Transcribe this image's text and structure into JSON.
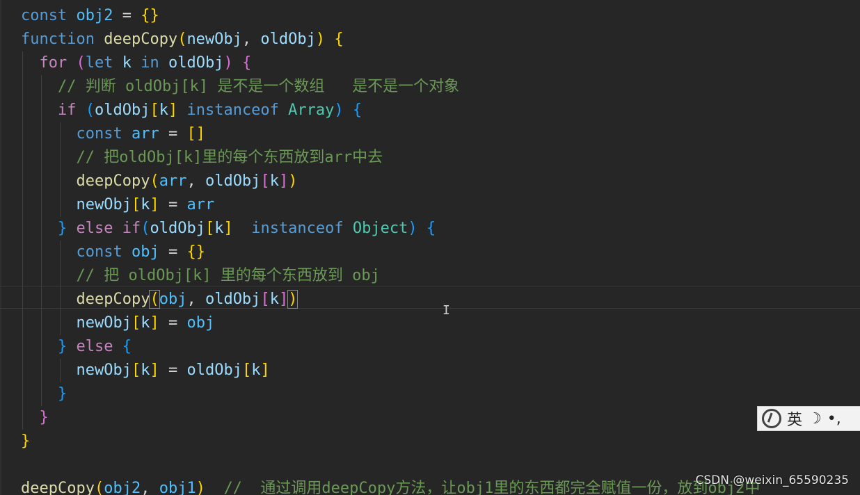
{
  "colors": {
    "keyword": "#569cd6",
    "control": "#c586c0",
    "function": "#dcdcaa",
    "variable": "#9cdcfe",
    "constant": "#4fc1ff",
    "type": "#4ec9b0",
    "comment": "#6a9955",
    "punct": "#d4d4d4",
    "bracket1": "#ffd700",
    "bracket2": "#da70d6",
    "bracket3": "#179fff"
  },
  "lines": [
    [
      {
        "t": "const",
        "c": "keyword"
      },
      {
        "t": " ",
        "c": "punct"
      },
      {
        "t": "obj2",
        "c": "constant"
      },
      {
        "t": " = ",
        "c": "punct"
      },
      {
        "t": "{}",
        "c": "bracket1"
      }
    ],
    [
      {
        "t": "function",
        "c": "keyword"
      },
      {
        "t": " ",
        "c": "punct"
      },
      {
        "t": "deepCopy",
        "c": "function"
      },
      {
        "t": "(",
        "c": "bracket1"
      },
      {
        "t": "newObj",
        "c": "variable"
      },
      {
        "t": ", ",
        "c": "punct"
      },
      {
        "t": "oldObj",
        "c": "variable"
      },
      {
        "t": ")",
        "c": "bracket1"
      },
      {
        "t": " ",
        "c": "punct"
      },
      {
        "t": "{",
        "c": "bracket1"
      }
    ],
    [
      {
        "t": "  ",
        "c": "punct"
      },
      {
        "t": "for",
        "c": "control"
      },
      {
        "t": " ",
        "c": "punct"
      },
      {
        "t": "(",
        "c": "bracket2"
      },
      {
        "t": "let",
        "c": "keyword"
      },
      {
        "t": " ",
        "c": "punct"
      },
      {
        "t": "k",
        "c": "variable"
      },
      {
        "t": " ",
        "c": "punct"
      },
      {
        "t": "in",
        "c": "keyword"
      },
      {
        "t": " ",
        "c": "punct"
      },
      {
        "t": "oldObj",
        "c": "variable"
      },
      {
        "t": ")",
        "c": "bracket2"
      },
      {
        "t": " ",
        "c": "punct"
      },
      {
        "t": "{",
        "c": "bracket2"
      }
    ],
    [
      {
        "t": "    ",
        "c": "punct"
      },
      {
        "t": "// 判断 oldObj[k] 是不是一个数组   是不是一个对象",
        "c": "comment"
      }
    ],
    [
      {
        "t": "    ",
        "c": "punct"
      },
      {
        "t": "if",
        "c": "control"
      },
      {
        "t": " ",
        "c": "punct"
      },
      {
        "t": "(",
        "c": "bracket3"
      },
      {
        "t": "oldObj",
        "c": "variable"
      },
      {
        "t": "[",
        "c": "bracket1"
      },
      {
        "t": "k",
        "c": "variable"
      },
      {
        "t": "]",
        "c": "bracket1"
      },
      {
        "t": " ",
        "c": "punct"
      },
      {
        "t": "instanceof",
        "c": "keyword"
      },
      {
        "t": " ",
        "c": "punct"
      },
      {
        "t": "Array",
        "c": "type"
      },
      {
        "t": ")",
        "c": "bracket3"
      },
      {
        "t": " ",
        "c": "punct"
      },
      {
        "t": "{",
        "c": "bracket3"
      }
    ],
    [
      {
        "t": "      ",
        "c": "punct"
      },
      {
        "t": "const",
        "c": "keyword"
      },
      {
        "t": " ",
        "c": "punct"
      },
      {
        "t": "arr",
        "c": "constant"
      },
      {
        "t": " = ",
        "c": "punct"
      },
      {
        "t": "[]",
        "c": "bracket1"
      }
    ],
    [
      {
        "t": "      ",
        "c": "punct"
      },
      {
        "t": "// 把oldObj[k]里的每个东西放到arr中去",
        "c": "comment"
      }
    ],
    [
      {
        "t": "      ",
        "c": "punct"
      },
      {
        "t": "deepCopy",
        "c": "function"
      },
      {
        "t": "(",
        "c": "bracket1"
      },
      {
        "t": "arr",
        "c": "constant"
      },
      {
        "t": ", ",
        "c": "punct"
      },
      {
        "t": "oldObj",
        "c": "variable"
      },
      {
        "t": "[",
        "c": "bracket2"
      },
      {
        "t": "k",
        "c": "variable"
      },
      {
        "t": "]",
        "c": "bracket2"
      },
      {
        "t": ")",
        "c": "bracket1"
      }
    ],
    [
      {
        "t": "      ",
        "c": "punct"
      },
      {
        "t": "newObj",
        "c": "variable"
      },
      {
        "t": "[",
        "c": "bracket1"
      },
      {
        "t": "k",
        "c": "variable"
      },
      {
        "t": "]",
        "c": "bracket1"
      },
      {
        "t": " = ",
        "c": "punct"
      },
      {
        "t": "arr",
        "c": "constant"
      }
    ],
    [
      {
        "t": "    ",
        "c": "punct"
      },
      {
        "t": "}",
        "c": "bracket3"
      },
      {
        "t": " ",
        "c": "punct"
      },
      {
        "t": "else",
        "c": "control"
      },
      {
        "t": " ",
        "c": "punct"
      },
      {
        "t": "if",
        "c": "control"
      },
      {
        "t": "(",
        "c": "bracket3"
      },
      {
        "t": "oldObj",
        "c": "variable"
      },
      {
        "t": "[",
        "c": "bracket1"
      },
      {
        "t": "k",
        "c": "variable"
      },
      {
        "t": "]",
        "c": "bracket1"
      },
      {
        "t": "  ",
        "c": "punct"
      },
      {
        "t": "instanceof",
        "c": "keyword"
      },
      {
        "t": " ",
        "c": "punct"
      },
      {
        "t": "Object",
        "c": "type"
      },
      {
        "t": ")",
        "c": "bracket3"
      },
      {
        "t": " ",
        "c": "punct"
      },
      {
        "t": "{",
        "c": "bracket3"
      }
    ],
    [
      {
        "t": "      ",
        "c": "punct"
      },
      {
        "t": "const",
        "c": "keyword"
      },
      {
        "t": " ",
        "c": "punct"
      },
      {
        "t": "obj",
        "c": "constant"
      },
      {
        "t": " = ",
        "c": "punct"
      },
      {
        "t": "{}",
        "c": "bracket1"
      }
    ],
    [
      {
        "t": "      ",
        "c": "punct"
      },
      {
        "t": "// 把 oldObj[k] 里的每个东西放到 obj",
        "c": "comment"
      }
    ],
    [
      {
        "t": "      ",
        "c": "punct"
      },
      {
        "t": "deepCopy",
        "c": "function"
      },
      {
        "t": "(",
        "c": "bracket1",
        "box": true
      },
      {
        "t": "obj",
        "c": "constant"
      },
      {
        "t": ", ",
        "c": "punct"
      },
      {
        "t": "oldObj",
        "c": "variable"
      },
      {
        "t": "[",
        "c": "bracket2"
      },
      {
        "t": "k",
        "c": "variable"
      },
      {
        "t": "]",
        "c": "bracket2"
      },
      {
        "t": ")",
        "c": "bracket1",
        "box": true
      }
    ],
    [
      {
        "t": "      ",
        "c": "punct"
      },
      {
        "t": "newObj",
        "c": "variable"
      },
      {
        "t": "[",
        "c": "bracket1"
      },
      {
        "t": "k",
        "c": "variable"
      },
      {
        "t": "]",
        "c": "bracket1"
      },
      {
        "t": " = ",
        "c": "punct"
      },
      {
        "t": "obj",
        "c": "constant"
      }
    ],
    [
      {
        "t": "    ",
        "c": "punct"
      },
      {
        "t": "}",
        "c": "bracket3"
      },
      {
        "t": " ",
        "c": "punct"
      },
      {
        "t": "else",
        "c": "control"
      },
      {
        "t": " ",
        "c": "punct"
      },
      {
        "t": "{",
        "c": "bracket3"
      }
    ],
    [
      {
        "t": "      ",
        "c": "punct"
      },
      {
        "t": "newObj",
        "c": "variable"
      },
      {
        "t": "[",
        "c": "bracket1"
      },
      {
        "t": "k",
        "c": "variable"
      },
      {
        "t": "]",
        "c": "bracket1"
      },
      {
        "t": " = ",
        "c": "punct"
      },
      {
        "t": "oldObj",
        "c": "variable"
      },
      {
        "t": "[",
        "c": "bracket1"
      },
      {
        "t": "k",
        "c": "variable"
      },
      {
        "t": "]",
        "c": "bracket1"
      }
    ],
    [
      {
        "t": "    ",
        "c": "punct"
      },
      {
        "t": "}",
        "c": "bracket3"
      }
    ],
    [
      {
        "t": "  ",
        "c": "punct"
      },
      {
        "t": "}",
        "c": "bracket2"
      }
    ],
    [
      {
        "t": "}",
        "c": "bracket1"
      }
    ],
    [],
    [
      {
        "t": "deepCopy",
        "c": "function"
      },
      {
        "t": "(",
        "c": "bracket1"
      },
      {
        "t": "obj2",
        "c": "constant"
      },
      {
        "t": ", ",
        "c": "punct"
      },
      {
        "t": "obj1",
        "c": "constant"
      },
      {
        "t": ")",
        "c": "bracket1"
      },
      {
        "t": "  ",
        "c": "punct"
      },
      {
        "t": "//  通过调用deepCopy方法，让obj1里的东西都完全赋值一份，放到obj2中",
        "c": "comment"
      }
    ]
  ],
  "ime": {
    "label": "英",
    "moon": "☽",
    "dots": "•,"
  },
  "watermark": "CSDN @weixin_65590235",
  "cursor_glyph": "I"
}
